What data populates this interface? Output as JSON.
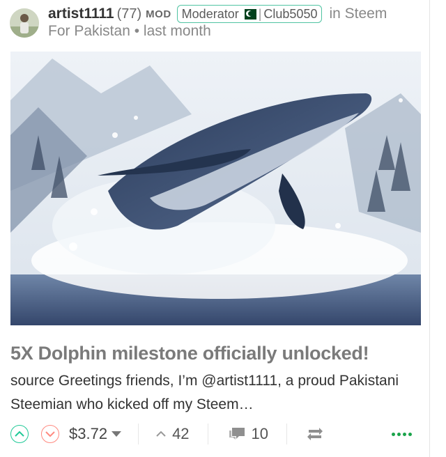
{
  "post": {
    "author": "artist1111",
    "reputation": "(77)",
    "mod_label": "MOD",
    "badge": {
      "role": "Moderator",
      "sep": "|",
      "club": "Club5050"
    },
    "community_prefix": "in Steem",
    "community_line2": "For Pakistan",
    "time": "last month",
    "title": "5X Dolphin milestone officially unlocked!",
    "excerpt": "source Greetings friends, I’m @artist1111, a proud Pakistani Steemian who kicked off my Steem…"
  },
  "footer": {
    "payout": "$3.72",
    "votes": "42",
    "comments": "10"
  },
  "colors": {
    "upvote": "#20c997",
    "downvote": "#ff8a80",
    "accent_green": "#1aa34a",
    "badge_border": "#4fc3a1"
  },
  "icons": [
    "upvote-icon",
    "downvote-icon",
    "caret-down-icon",
    "votes-chevron-icon",
    "comments-icon",
    "reblog-icon",
    "more-icon"
  ]
}
